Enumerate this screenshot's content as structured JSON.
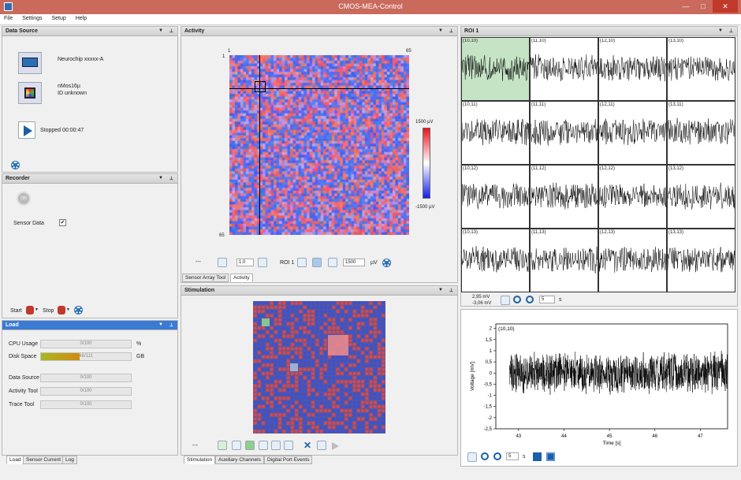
{
  "window": {
    "title": "CMOS-MEA-Control"
  },
  "menu": [
    "File",
    "Settings",
    "Setup",
    "Help"
  ],
  "data_source": {
    "title": "Data Source",
    "device_name": "Neurochip xxxxx-A",
    "chip_name": "nMos16µ",
    "chip_id": "ID unknown",
    "status": "Stopped 00:00:47"
  },
  "recorder": {
    "title": "Recorder",
    "on_label": "ON",
    "sensor_data_label": "Sensor Data",
    "sensor_data_checked": "✔",
    "start_label": "Start",
    "stop_label": "Stop"
  },
  "load": {
    "title": "Load",
    "cpu_label": "CPU Usage",
    "cpu_value": "0/100",
    "cpu_unit": "%",
    "disk_label": "Disk Space",
    "disk_value": "48/111",
    "disk_fraction": 0.43,
    "disk_unit": "GB",
    "ds_label": "Data Source",
    "ds_value": "0/100",
    "at_label": "Activity Tool",
    "at_value": "0/100",
    "tt_label": "Trace Tool",
    "tt_value": "0/100"
  },
  "left_tabs": [
    "Load",
    "Sensor Current",
    "Log"
  ],
  "activity": {
    "title": "Activity",
    "axis_start_top": "1",
    "axis_end_top": "65",
    "axis_start_left": "1",
    "axis_end_left": "65",
    "scale_max": "1500 µV",
    "scale_min": "-1500 µV",
    "toolbar": {
      "dots": "---",
      "gain_value": "1.0",
      "roi_label": "ROI 1",
      "range_value": "1500",
      "range_unit": "µV"
    },
    "tabs": [
      "Sensor Array Tool",
      "Activity"
    ]
  },
  "stimulation": {
    "title": "Stimulation",
    "dots": "---",
    "tabs": [
      "Stimulation",
      "Auxiliary Channels",
      "Digital Port Events"
    ]
  },
  "roi": {
    "title": "ROI 1",
    "cells": [
      [
        "(10,10)",
        "(11,10)",
        "(12,10)",
        "(13,10)"
      ],
      [
        "(10,11)",
        "(11,11)",
        "(12,11)",
        "(13,11)"
      ],
      [
        "(10,12)",
        "(11,12)",
        "(12,12)",
        "(13,12)"
      ],
      [
        "(10,13)",
        "(11,13)",
        "(12,13)",
        "(13,13)"
      ]
    ],
    "range_max": "2,95 mV",
    "range_min": "-3,06 mV",
    "window_value": "5",
    "window_unit": "s"
  },
  "trace": {
    "label": "(10,10)",
    "window_value": "5",
    "window_unit": "s"
  },
  "chart_data": {
    "type": "line",
    "title": "",
    "xlabel": "Time [s]",
    "ylabel": "Voltage [mV]",
    "x_ticks": [
      "43",
      "44",
      "45",
      "46",
      "47"
    ],
    "y_ticks": [
      "2",
      "1,5",
      "1",
      "0,5",
      "0",
      "-0,5",
      "-1",
      "-1,5",
      "-2",
      "-2,5"
    ],
    "xlim": [
      42.5,
      47.6
    ],
    "ylim": [
      -2.5,
      2.2
    ],
    "series": [
      {
        "values": "noise band between approximately -1.0 and 1.0 mV"
      }
    ]
  }
}
